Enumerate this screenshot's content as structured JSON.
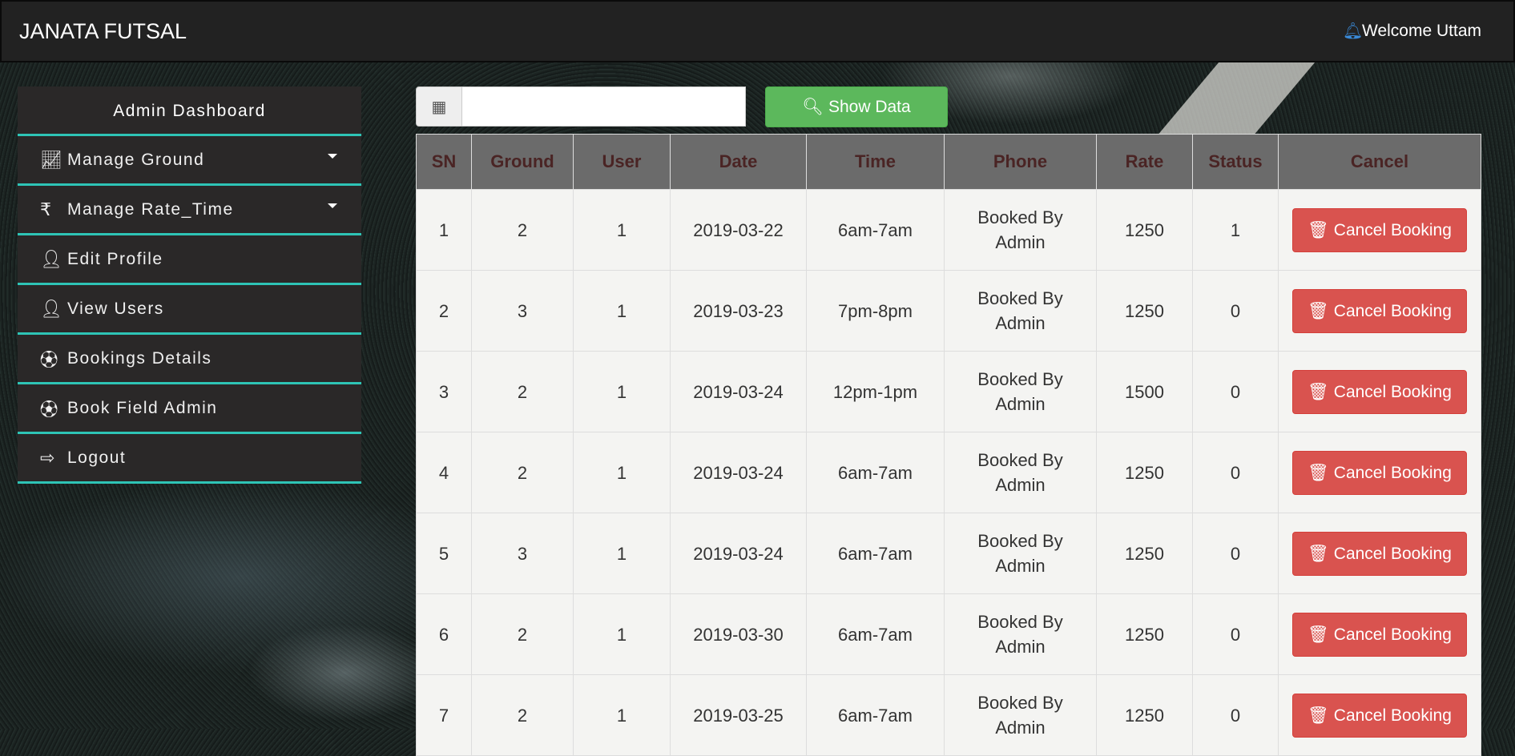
{
  "navbar": {
    "brand": "JANATA FUTSAL",
    "welcome": "Welcome Uttam",
    "bell_icon": "bell-icon"
  },
  "sidebar": {
    "title": "Admin Dashboard",
    "items": [
      {
        "label": "Manage Ground",
        "icon": "area-chart-icon",
        "dropdown": true
      },
      {
        "label": "Manage Rate_Time",
        "icon": "rupee-icon",
        "dropdown": true
      },
      {
        "label": "Edit Profile",
        "icon": "user-icon"
      },
      {
        "label": "View Users",
        "icon": "user-icon"
      },
      {
        "label": "Bookings Details",
        "icon": "soccer-ball-icon"
      },
      {
        "label": "Book Field Admin",
        "icon": "soccer-ball-icon"
      },
      {
        "label": "Logout",
        "icon": "logout-icon"
      }
    ]
  },
  "filter": {
    "date_value": "",
    "show_label": "Show Data"
  },
  "table": {
    "headers": [
      "SN",
      "Ground",
      "User",
      "Date",
      "Time",
      "Phone",
      "Rate",
      "Status",
      "Cancel"
    ],
    "cancel_label": "Cancel Booking",
    "rows": [
      [
        "1",
        "2",
        "1",
        "2019-03-22",
        "6am-7am",
        "Booked By Admin",
        "1250",
        "1"
      ],
      [
        "2",
        "3",
        "1",
        "2019-03-23",
        "7pm-8pm",
        "Booked By Admin",
        "1250",
        "0"
      ],
      [
        "3",
        "2",
        "1",
        "2019-03-24",
        "12pm-1pm",
        "Booked By Admin",
        "1500",
        "0"
      ],
      [
        "4",
        "2",
        "1",
        "2019-03-24",
        "6am-7am",
        "Booked By Admin",
        "1250",
        "0"
      ],
      [
        "5",
        "3",
        "1",
        "2019-03-24",
        "6am-7am",
        "Booked By Admin",
        "1250",
        "0"
      ],
      [
        "6",
        "2",
        "1",
        "2019-03-30",
        "6am-7am",
        "Booked By Admin",
        "1250",
        "0"
      ],
      [
        "7",
        "2",
        "1",
        "2019-03-25",
        "6am-7am",
        "Booked By Admin",
        "1250",
        "0"
      ]
    ]
  }
}
